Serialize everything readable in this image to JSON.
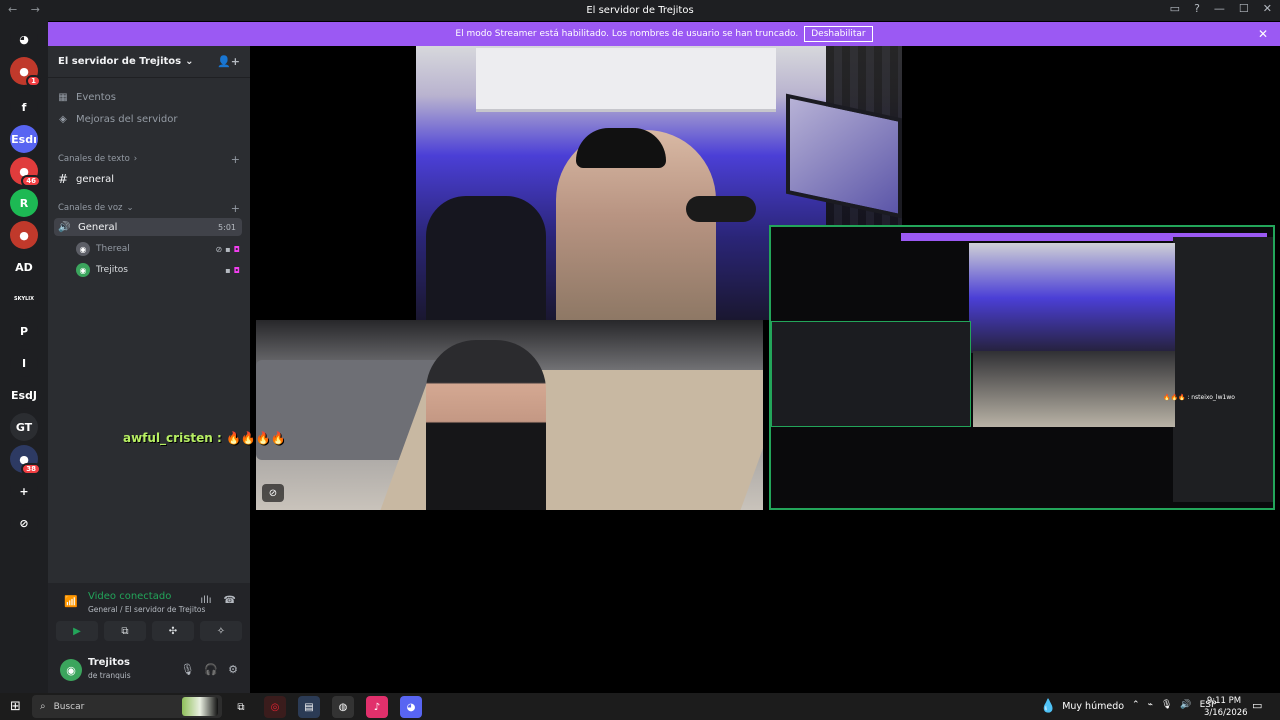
{
  "window": {
    "title": "El servidor de Trejitos",
    "nav_back": "←",
    "nav_forward": "→",
    "controls": [
      "▭",
      "?",
      "—",
      "☐",
      "✕"
    ]
  },
  "banner": {
    "text": "El modo Streamer está habilitado. Los nombres de usuario se han truncado.",
    "button": "Deshabilitar",
    "close": "✕"
  },
  "guilds": {
    "items": [
      {
        "label": "",
        "icon": "discord-icon",
        "color": "#1e1f22"
      },
      {
        "label": "",
        "icon": "avatar",
        "badge": "1",
        "color": "#c0392b"
      },
      {
        "label": "f",
        "icon": "",
        "color": "#1e1f22"
      },
      {
        "label": "Esdı",
        "icon": "",
        "color": "#5865f2"
      },
      {
        "label": "",
        "icon": "app-icon",
        "badge": "46",
        "color": "#e03c3c"
      },
      {
        "label": "",
        "icon": "r-icon",
        "color": "#1db954"
      },
      {
        "label": "",
        "icon": "avatar",
        "color": "#c0392b"
      },
      {
        "label": "AD",
        "icon": "",
        "color": "#1e1f22"
      },
      {
        "label": "SKYLIX",
        "icon": "",
        "color": "#1e1f22"
      },
      {
        "label": "P",
        "icon": "",
        "color": "#1e1f22"
      },
      {
        "label": "I",
        "icon": "",
        "color": "#1e1f22"
      },
      {
        "label": "EsdJ",
        "icon": "",
        "color": "#1e1f22"
      },
      {
        "label": "GT",
        "icon": "",
        "color": "#2b2d31"
      },
      {
        "label": "",
        "icon": "avatar",
        "badge": "38",
        "color": "#2d3a63"
      },
      {
        "label": "+",
        "icon": "add-server-icon",
        "color": "#1e1f22"
      },
      {
        "label": "⊘",
        "icon": "explore-icon",
        "color": "#1e1f22"
      }
    ]
  },
  "server": {
    "name": "El servidor de Trejitos",
    "chevron": "⌄",
    "events": "Eventos",
    "boosts": "Mejoras del servidor",
    "text_category": "Canales de texto",
    "text_channel": "general",
    "voice_category": "Canales de voz",
    "voice_channel": "General",
    "voice_timer": "5:01",
    "voice_users": [
      {
        "name": "Thereal"
      },
      {
        "name": "Trejitos"
      }
    ]
  },
  "voice_panel": {
    "status": "Video conectado",
    "location": "General / El servidor de Trejitos"
  },
  "user": {
    "name": "Trejitos",
    "status": "de tranquis"
  },
  "stage": {
    "overlay_name": "awful_cristen :",
    "overlay_emoji": "🔥🔥🔥🔥",
    "inner_text": "🔥🔥🔥 : nsteixo_lw1wo"
  },
  "taskbar": {
    "search": "Buscar",
    "weather": "Muy húmedo",
    "lang": "ESP",
    "time": "9:11 PM",
    "date": "3/16/2026"
  }
}
